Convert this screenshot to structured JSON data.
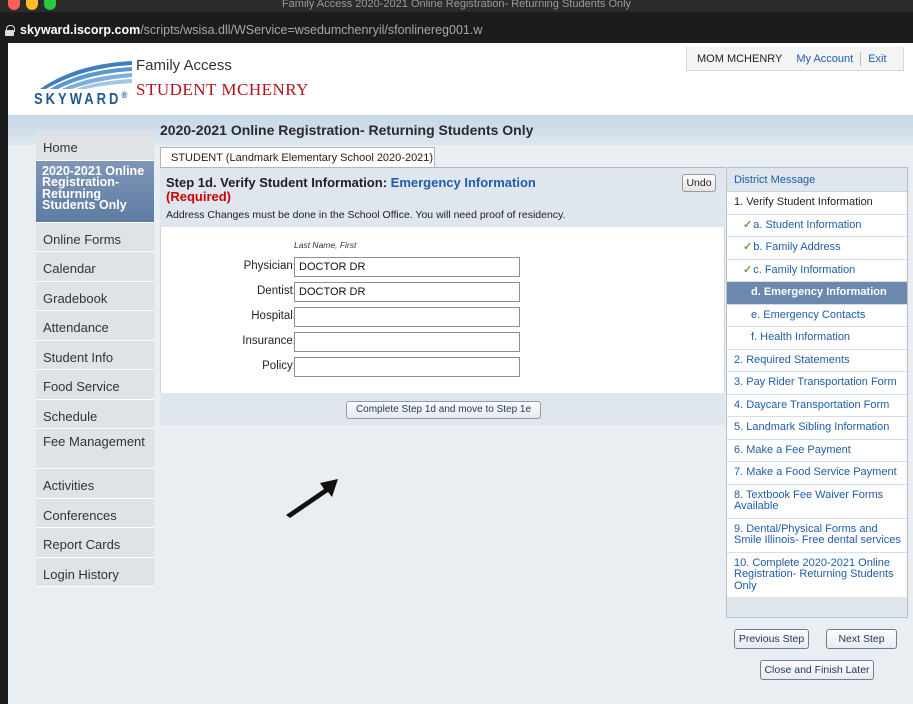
{
  "browser": {
    "window_title": "Family Access 2020-2021 Online Registration- Returning Students Only",
    "url_domain": "skyward.iscorp.com",
    "url_path": "/scripts/wsisa.dll/WService=wsedumchenryil/sfonlinereg001.w"
  },
  "header": {
    "logo_text": "SKYWARD",
    "logo_mark": "®",
    "app_name": "Family Access",
    "district_name": "STUDENT MCHENRY",
    "user_name": "MOM MCHENRY",
    "my_account": "My Account",
    "exit": "Exit"
  },
  "sidebar": {
    "items": [
      {
        "label": "Home"
      },
      {
        "label": "2020-2021 Online Registration- Returning Students Only"
      },
      {
        "label": "Online Forms"
      },
      {
        "label": "Calendar"
      },
      {
        "label": "Gradebook"
      },
      {
        "label": "Attendance"
      },
      {
        "label": "Student Info"
      },
      {
        "label": "Food Service"
      },
      {
        "label": "Schedule"
      },
      {
        "label": "Fee Management"
      },
      {
        "label": "Activities"
      },
      {
        "label": "Conferences"
      },
      {
        "label": "Report Cards"
      },
      {
        "label": "Login History"
      }
    ]
  },
  "main": {
    "title": "2020-2021 Online Registration- Returning Students Only",
    "student_tab": "STUDENT (Landmark Elementary School 2020-2021)",
    "step_title": "Step 1d. Verify Student Information:",
    "step_section": "Emergency Information",
    "step_required": "(Required)",
    "step_note": "Address Changes must be done in the School Office. You will need proof of residency.",
    "undo": "Undo",
    "field_caption": "Last Name, First",
    "fields": [
      {
        "label": "Physician:",
        "value": "DOCTOR DR"
      },
      {
        "label": "Dentist:",
        "value": "DOCTOR DR"
      },
      {
        "label": "Hospital:",
        "value": ""
      },
      {
        "label": "Insurance:",
        "value": ""
      },
      {
        "label": "Policy:",
        "value": ""
      }
    ],
    "submit": "Complete Step 1d and move to Step 1e"
  },
  "steps_panel": {
    "header": "District Message",
    "items": [
      {
        "label": "1. Verify Student Information"
      },
      {
        "label": "a. Student Information"
      },
      {
        "label": "b. Family Address"
      },
      {
        "label": "c. Family Information"
      },
      {
        "label": "d. Emergency Information"
      },
      {
        "label": "e. Emergency Contacts"
      },
      {
        "label": "f. Health Information"
      },
      {
        "label": "2. Required Statements"
      },
      {
        "label": "3. Pay Rider Transportation Form"
      },
      {
        "label": "4. Daycare Transportation Form"
      },
      {
        "label": "5. Landmark Sibling Information"
      },
      {
        "label": "6. Make a Fee Payment"
      },
      {
        "label": "7. Make a Food Service Payment"
      },
      {
        "label": "8. Textbook Fee Waiver Forms Available"
      },
      {
        "label": "9. Dental/Physical Forms and Smile Illinois- Free dental services"
      },
      {
        "label": "10. Complete 2020-2021 Online Registration- Returning Students Only"
      }
    ],
    "previous_step": "Previous Step",
    "next_step": "Next Step",
    "close_finish": "Close and Finish Later"
  }
}
